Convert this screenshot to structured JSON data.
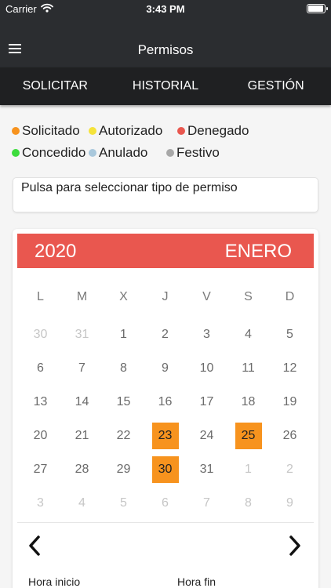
{
  "status": {
    "carrier": "Carrier",
    "time": "3:43 PM"
  },
  "navbar": {
    "title": "Permisos"
  },
  "tabs": [
    "SOLICITAR",
    "HISTORIAL",
    "GESTIÓN"
  ],
  "legend": [
    [
      {
        "label": "Solicitado",
        "color": "#f7931e"
      },
      {
        "label": "Autorizado",
        "color": "#f5e33a"
      },
      {
        "label": "Denegado",
        "color": "#e9574f"
      }
    ],
    [
      {
        "label": "Concedido",
        "color": "#3ddc3d"
      },
      {
        "label": "Anulado",
        "color": "#a9c8dc"
      },
      {
        "label": "Festivo",
        "color": "#a8a8a8"
      }
    ]
  ],
  "permit_select": {
    "placeholder": "Pulsa para seleccionar tipo de permiso"
  },
  "calendar": {
    "year": "2020",
    "month": "ENERO",
    "weekdays": [
      "L",
      "M",
      "X",
      "J",
      "V",
      "S",
      "D"
    ],
    "weeks": [
      [
        {
          "d": "30",
          "m": true
        },
        {
          "d": "31",
          "m": true
        },
        {
          "d": "1"
        },
        {
          "d": "2"
        },
        {
          "d": "3"
        },
        {
          "d": "4"
        },
        {
          "d": "5"
        }
      ],
      [
        {
          "d": "6"
        },
        {
          "d": "7"
        },
        {
          "d": "8"
        },
        {
          "d": "9"
        },
        {
          "d": "10"
        },
        {
          "d": "11"
        },
        {
          "d": "12"
        }
      ],
      [
        {
          "d": "13"
        },
        {
          "d": "14"
        },
        {
          "d": "15"
        },
        {
          "d": "16"
        },
        {
          "d": "17"
        },
        {
          "d": "18"
        },
        {
          "d": "19"
        }
      ],
      [
        {
          "d": "20"
        },
        {
          "d": "21"
        },
        {
          "d": "22"
        },
        {
          "d": "23",
          "h": true
        },
        {
          "d": "24"
        },
        {
          "d": "25",
          "h": true
        },
        {
          "d": "26"
        }
      ],
      [
        {
          "d": "27"
        },
        {
          "d": "28"
        },
        {
          "d": "29"
        },
        {
          "d": "30",
          "h": true
        },
        {
          "d": "31"
        },
        {
          "d": "1",
          "m": true
        },
        {
          "d": "2",
          "m": true
        }
      ],
      [
        {
          "d": "3",
          "m": true
        },
        {
          "d": "4",
          "m": true
        },
        {
          "d": "5",
          "m": true
        },
        {
          "d": "6",
          "m": true
        },
        {
          "d": "7",
          "m": true
        },
        {
          "d": "8",
          "m": true
        },
        {
          "d": "9",
          "m": true
        }
      ]
    ],
    "prev_icon": "chevron-left-icon",
    "next_icon": "chevron-right-icon"
  },
  "time": {
    "start_label": "Hora inicio",
    "end_label": "Hora fin"
  }
}
